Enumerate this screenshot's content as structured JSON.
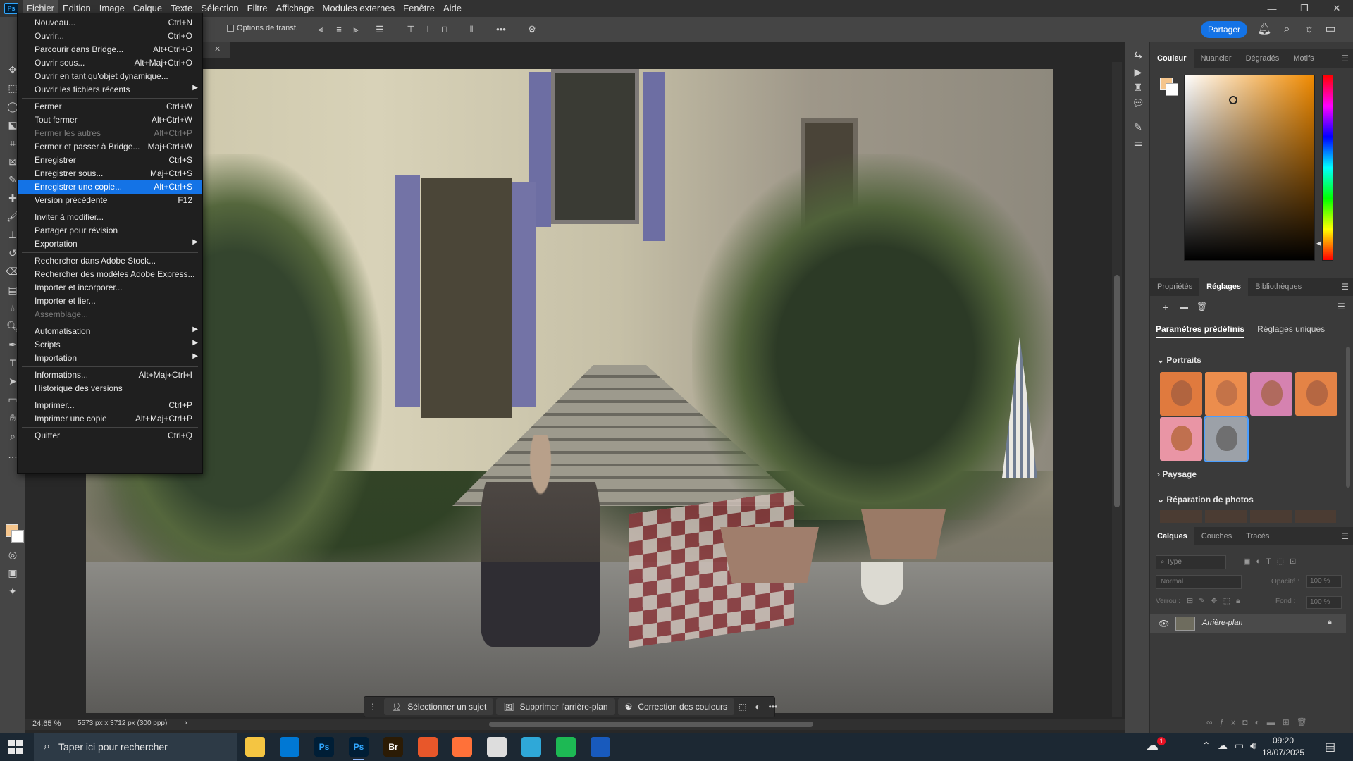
{
  "app": {
    "logo": "Ps"
  },
  "menubar": {
    "items": [
      "Fichier",
      "Edition",
      "Image",
      "Calque",
      "Texte",
      "Sélection",
      "Filtre",
      "Affichage",
      "Modules externes",
      "Fenêtre",
      "Aide"
    ]
  },
  "window_controls": {
    "minimize": "—",
    "restore": "❐",
    "close": "✕"
  },
  "options_bar": {
    "transform_label": "Options de transf.",
    "share_label": "Partager"
  },
  "file_menu": {
    "items": [
      {
        "label": "Nouveau...",
        "shortcut": "Ctrl+N"
      },
      {
        "label": "Ouvrir...",
        "shortcut": "Ctrl+O"
      },
      {
        "label": "Parcourir dans Bridge...",
        "shortcut": "Alt+Ctrl+O"
      },
      {
        "label": "Ouvrir sous...",
        "shortcut": "Alt+Maj+Ctrl+O"
      },
      {
        "label": "Ouvrir en tant qu'objet dynamique...",
        "shortcut": ""
      },
      {
        "label": "Ouvrir les fichiers récents",
        "shortcut": "",
        "submenu": true
      },
      {
        "label": "Fermer",
        "shortcut": "Ctrl+W"
      },
      {
        "label": "Tout fermer",
        "shortcut": "Alt+Ctrl+W"
      },
      {
        "label": "Fermer les autres",
        "shortcut": "Alt+Ctrl+P",
        "disabled": true
      },
      {
        "label": "Fermer et passer à Bridge...",
        "shortcut": "Maj+Ctrl+W"
      },
      {
        "label": "Enregistrer",
        "shortcut": "Ctrl+S"
      },
      {
        "label": "Enregistrer sous...",
        "shortcut": "Maj+Ctrl+S"
      },
      {
        "label": "Enregistrer une copie...",
        "shortcut": "Alt+Ctrl+S",
        "highlighted": true
      },
      {
        "label": "Version précédente",
        "shortcut": "F12"
      },
      {
        "label": "Inviter à modifier...",
        "shortcut": ""
      },
      {
        "label": "Partager pour révision",
        "shortcut": ""
      },
      {
        "label": "Exportation",
        "shortcut": "",
        "submenu": true
      },
      {
        "label": "Rechercher dans Adobe Stock...",
        "shortcut": ""
      },
      {
        "label": "Rechercher des modèles Adobe Express...",
        "shortcut": ""
      },
      {
        "label": "Importer et incorporer...",
        "shortcut": ""
      },
      {
        "label": "Importer et lier...",
        "shortcut": ""
      },
      {
        "label": "Assemblage...",
        "shortcut": "",
        "disabled": true
      },
      {
        "label": "Automatisation",
        "shortcut": "",
        "submenu": true
      },
      {
        "label": "Scripts",
        "shortcut": "",
        "submenu": true
      },
      {
        "label": "Importation",
        "shortcut": "",
        "submenu": true
      },
      {
        "label": "Informations...",
        "shortcut": "Alt+Maj+Ctrl+I"
      },
      {
        "label": "Historique des versions",
        "shortcut": ""
      },
      {
        "label": "Imprimer...",
        "shortcut": "Ctrl+P"
      },
      {
        "label": "Imprimer une copie",
        "shortcut": "Alt+Maj+Ctrl+P"
      },
      {
        "label": "Quitter",
        "shortcut": "Ctrl+Q"
      }
    ]
  },
  "status": {
    "zoom": "24.65 %",
    "doc_size": "5573 px x 3712 px (300 ppp)",
    "arrow": "›"
  },
  "context_bar": {
    "select_subject": "Sélectionner un sujet",
    "remove_bg": "Supprimer l'arrière-plan",
    "color_correction": "Correction des couleurs",
    "more": "•••"
  },
  "color_panel": {
    "tabs": [
      "Couleur",
      "Nuancier",
      "Dégradés",
      "Motifs"
    ],
    "foreground": "#f5c58c",
    "background": "#ffffff"
  },
  "adjust_panel": {
    "tabs": [
      "Propriétés",
      "Réglages",
      "Bibliothèques"
    ],
    "subtabs": [
      "Paramètres prédéfinis",
      "Réglages uniques"
    ],
    "sections": {
      "portraits": "Portraits",
      "paysage": "Paysage",
      "reparation": "Réparation de photos"
    }
  },
  "layers_panel": {
    "tabs": [
      "Calques",
      "Couches",
      "Tracés"
    ],
    "filter_placeholder": "Type",
    "blend_mode": "Normal",
    "opacity_label": "Opacité :",
    "opacity_value": "100 %",
    "lock_label": "Verrou :",
    "fill_label": "Fond :",
    "fill_value": "100 %",
    "layer_name": "Arrière-plan"
  },
  "taskbar": {
    "search_placeholder": "Taper ici pour rechercher",
    "time": "09:20",
    "date": "18/07/2025",
    "apps": [
      {
        "name": "file-explorer",
        "label": "",
        "color": "#f4c542"
      },
      {
        "name": "store",
        "label": "",
        "color": "#0078d4"
      },
      {
        "name": "photoshop-a",
        "label": "Ps",
        "color": "#001e36"
      },
      {
        "name": "photoshop-b",
        "label": "Ps",
        "color": "#001e36"
      },
      {
        "name": "bridge",
        "label": "Br",
        "color": "#2b1b05"
      },
      {
        "name": "app-orange",
        "label": "",
        "color": "#e8572a"
      },
      {
        "name": "firefox",
        "label": "",
        "color": "#ff7139"
      },
      {
        "name": "files",
        "label": "",
        "color": "#dddddd"
      },
      {
        "name": "photos",
        "label": "",
        "color": "#2fa8d8"
      },
      {
        "name": "spotify",
        "label": "",
        "color": "#1db954"
      },
      {
        "name": "word",
        "label": "",
        "color": "#185abd"
      }
    ],
    "notification_count": "1"
  }
}
